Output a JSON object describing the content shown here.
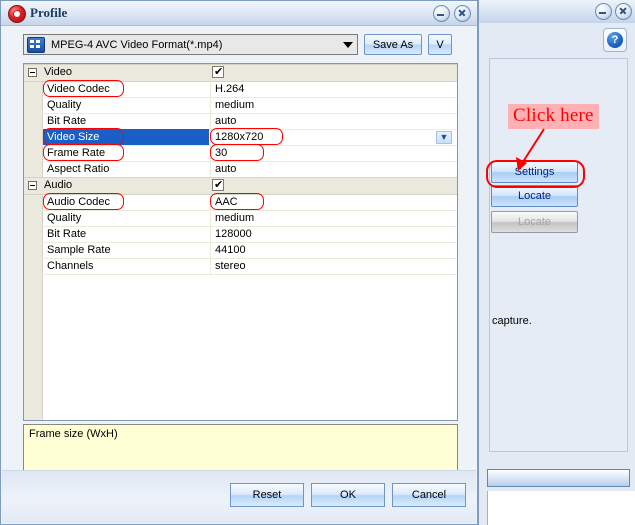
{
  "dialog": {
    "title": "Profile",
    "gear_icon": "gear-icon",
    "minimize_label": "Minimize",
    "close_label": "Close",
    "format": {
      "icon": "video-file-icon",
      "value": "MPEG-4 AVC Video Format(*.mp4)",
      "dropdown_icon": "chevron-down-icon",
      "save_as_label": "Save As",
      "v_label": "V"
    },
    "grid": {
      "sections": [
        {
          "name": "Video",
          "checked": true,
          "rows": [
            {
              "name": "Video Codec",
              "value": "H.264",
              "name_annotated": true,
              "value_annotated": false,
              "selected": false,
              "has_chevron": false
            },
            {
              "name": "Quality",
              "value": "medium",
              "name_annotated": false,
              "value_annotated": false,
              "selected": false,
              "has_chevron": false
            },
            {
              "name": "Bit Rate",
              "value": "auto",
              "name_annotated": false,
              "value_annotated": false,
              "selected": false,
              "has_chevron": false
            },
            {
              "name": "Video Size",
              "value": "1280x720",
              "name_annotated": true,
              "value_annotated": true,
              "selected": true,
              "has_chevron": true
            },
            {
              "name": "Frame Rate",
              "value": "30",
              "name_annotated": true,
              "value_annotated": true,
              "selected": false,
              "has_chevron": false
            },
            {
              "name": "Aspect Ratio",
              "value": "auto",
              "name_annotated": false,
              "value_annotated": false,
              "selected": false,
              "has_chevron": false
            }
          ]
        },
        {
          "name": "Audio",
          "checked": true,
          "rows": [
            {
              "name": "Audio Codec",
              "value": "AAC",
              "name_annotated": true,
              "value_annotated": true,
              "selected": false,
              "has_chevron": false
            },
            {
              "name": "Quality",
              "value": "medium",
              "name_annotated": false,
              "value_annotated": false,
              "selected": false,
              "has_chevron": false
            },
            {
              "name": "Bit Rate",
              "value": "128000",
              "name_annotated": false,
              "value_annotated": false,
              "selected": false,
              "has_chevron": false
            },
            {
              "name": "Sample Rate",
              "value": "44100",
              "name_annotated": false,
              "value_annotated": false,
              "selected": false,
              "has_chevron": false
            },
            {
              "name": "Channels",
              "value": "stereo",
              "name_annotated": false,
              "value_annotated": false,
              "selected": false,
              "has_chevron": false
            }
          ]
        }
      ]
    },
    "description": "Frame size (WxH)",
    "buttons": {
      "reset": "Reset",
      "ok": "OK",
      "cancel": "Cancel"
    }
  },
  "background_window": {
    "minimize_label": "Minimize",
    "close_label": "Close",
    "help_icon": "help-icon",
    "help_glyph": "?",
    "caption_text": "capture.",
    "buttons": [
      {
        "label": "Settings",
        "disabled": false
      },
      {
        "label": "Locate",
        "disabled": false
      },
      {
        "label": "Locate",
        "disabled": true
      }
    ]
  },
  "annotation": {
    "click_here_text": "Click here",
    "highlight_color": "#ffb0b4",
    "ink_color": "#ff0000"
  }
}
